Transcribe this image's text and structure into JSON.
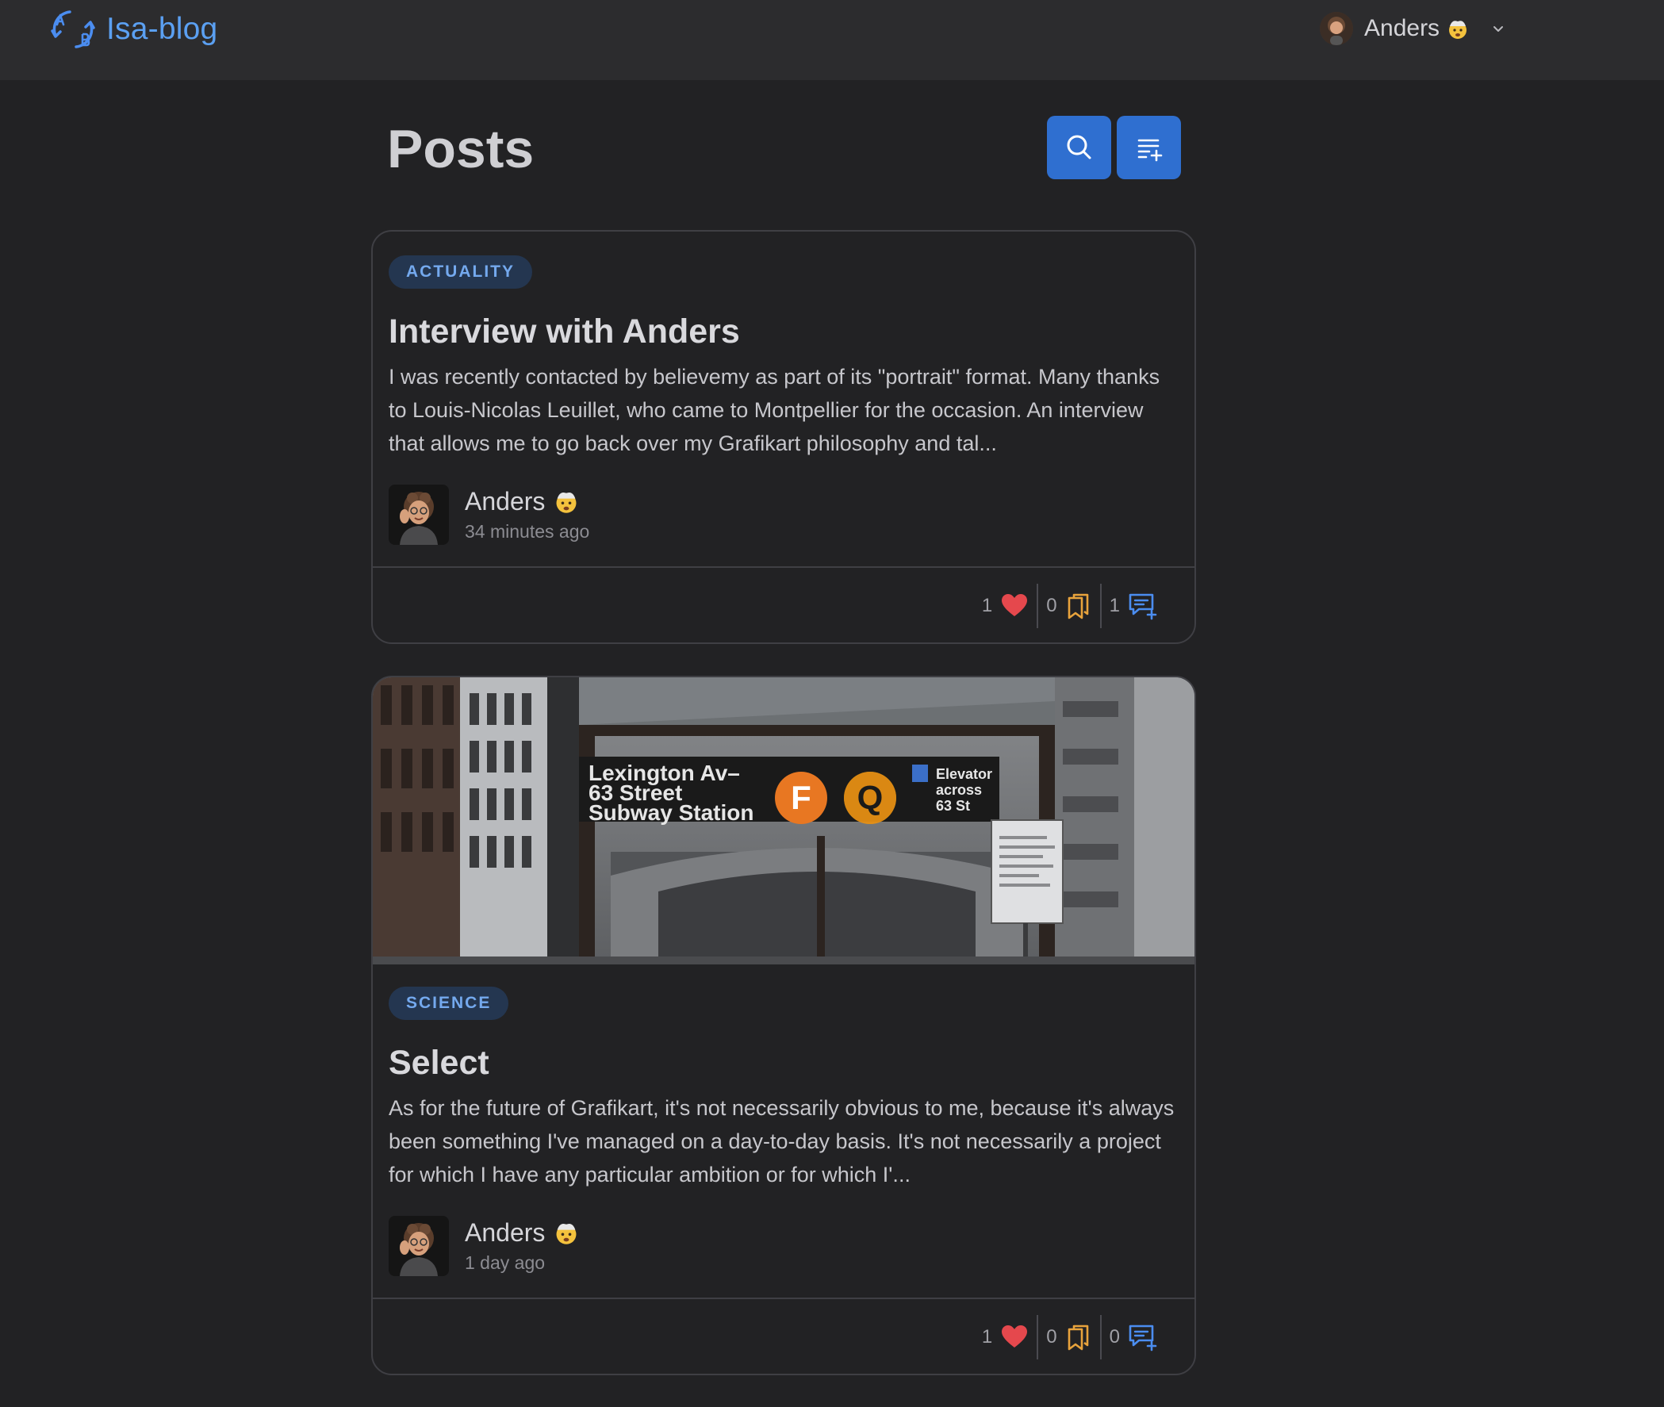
{
  "app": {
    "brand": "Isa-blog",
    "logo_icon": "ab-translate-logo-icon"
  },
  "nav": {
    "user_name": "Anders",
    "user_emoji": "exploding-head-emoji",
    "menu_icon": "chevron-down-icon"
  },
  "page": {
    "title": "Posts",
    "actions": [
      "search-icon",
      "add-post-icon"
    ]
  },
  "posts": [
    {
      "category": "ACTUALITY",
      "title": "Interview with Anders",
      "excerpt": "I was recently contacted by believemy as part of its \"portrait\" format. Many thanks to Louis-Nicolas Leuillet, who came to Montpellier for the occasion. An interview that allows me to go back over my Grafikart philosophy and tal...",
      "author": "Anders",
      "time": "34 minutes ago",
      "likes": "1",
      "bookmarks": "0",
      "comments": "1"
    },
    {
      "category": "SCIENCE",
      "title": "Select",
      "excerpt": "As for the future of Grafikart, it's not necessarily obvious to me, because it's always been something I've managed on a day-to-day basis. It's not necessarily a project for which I have any particular ambition or for which I'...",
      "author": "Anders",
      "time": "1 day ago",
      "likes": "1",
      "bookmarks": "0",
      "comments": "0",
      "cover": {
        "sign_line1": "Lexington Av–",
        "sign_line2": "63 Street",
        "sign_line3": "Subway Station",
        "route1": "F",
        "route2": "Q",
        "elevator_line1": "Elevator",
        "elevator_line2": "across",
        "elevator_line3": "63 St"
      }
    }
  ],
  "colors": {
    "background": "#222224",
    "topbar": "#2c2c2e",
    "accent": "#2f6fd0",
    "brand_text": "#5ba0f2",
    "like": "#e5484d",
    "bookmark": "#e8a33c",
    "comment": "#4b8df0"
  }
}
